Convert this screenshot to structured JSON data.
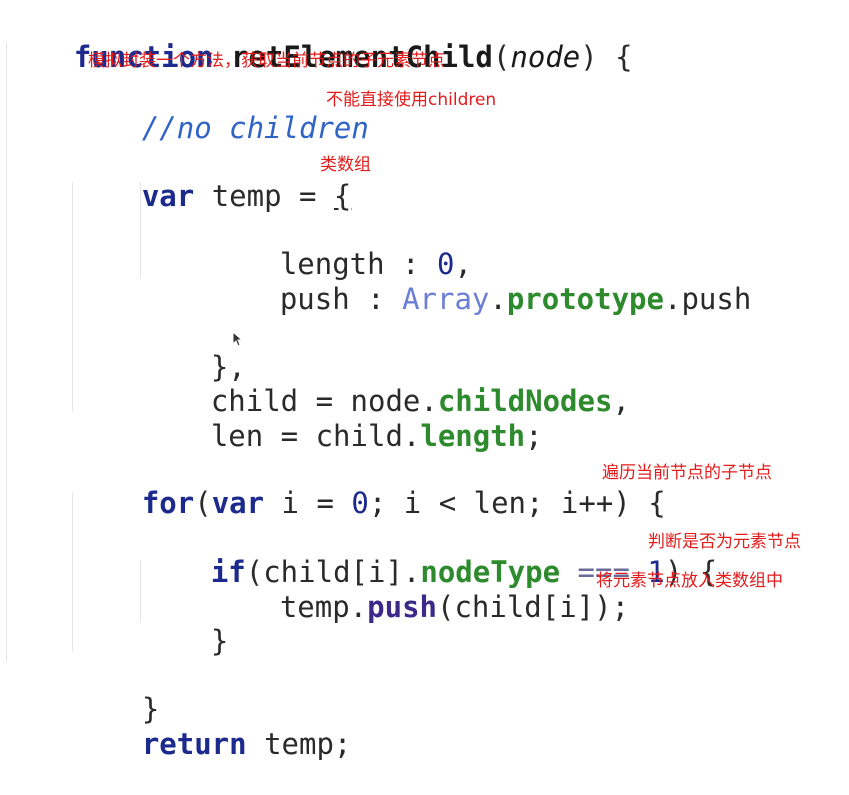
{
  "code": {
    "line1": {
      "kw": "function",
      "name": "retElementChild",
      "open": "(",
      "param": "node",
      "close": ")",
      "brace": " {"
    },
    "line2": {
      "comment": "//no children"
    },
    "line3": {
      "kw": "var",
      "rest": " temp = ",
      "brace": "{"
    },
    "line4": {
      "text": "length : ",
      "num": "0",
      "end": ","
    },
    "line5": {
      "text": "push : ",
      "cls": "Array",
      "dot1": ".",
      "prop": "prototype",
      "dot2": ".",
      "rest": "push"
    },
    "line6": {
      "text": "},"
    },
    "line7": {
      "text": "child = node.",
      "prop": "childNodes",
      "end": ","
    },
    "line8": {
      "text": "len = child.",
      "prop": "length",
      "end": ";"
    },
    "line9": {
      "kw1": "for",
      "p1": "(",
      "kw2": "var",
      "mid": " i = ",
      "num": "0",
      "rest": "; i < len; i++) {"
    },
    "line10": {
      "kw": "if",
      "p1": "(child[i].",
      "prop": "nodeType",
      "op": " === ",
      "num": "1",
      "rest": ") {"
    },
    "line11": {
      "text": "temp.",
      "method": "push",
      "rest": "(child[i]);"
    },
    "line12": {
      "text": "}"
    },
    "line13": {
      "text": "}"
    },
    "line14": {
      "kw": "return",
      "rest": " temp;"
    }
  },
  "notes": {
    "n1": "模拟封装一个方法，获取当前节点的子元素节点",
    "n2": "不能直接使用children",
    "n3": "类数组",
    "n4": "遍历当前节点的子节点",
    "n5": "判断是否为元素节点",
    "n6": "将元素节点放入类数组中"
  },
  "colors": {
    "keyword": "#1b2a8c",
    "comment": "#2f63c8",
    "property": "#2d8a2d",
    "annotation": "#e31b1b"
  }
}
